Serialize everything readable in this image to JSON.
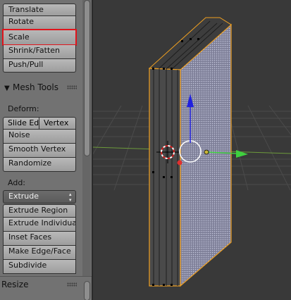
{
  "transform": {
    "buttons": [
      "Translate",
      "Rotate",
      "Scale",
      "Shrink/Fatten",
      "Push/Pull"
    ]
  },
  "mesh_tools": {
    "header": "Mesh Tools",
    "deform_label": "Deform:",
    "slide_edge": "Slide Ed",
    "vertex": "Vertex",
    "buttons": [
      "Noise",
      "Smooth Vertex",
      "Randomize"
    ],
    "add_label": "Add:",
    "extrude_select": "Extrude",
    "add_buttons": [
      "Extrude Region",
      "Extrude Individual",
      "Inset Faces",
      "Make Edge/Face",
      "Subdivide"
    ]
  },
  "resize_panel": {
    "title": "Resize"
  },
  "colors": {
    "highlight": "#e0141c",
    "selection_outline": "#f0a020",
    "axis_x": "#3fd13f",
    "axis_z": "#2020e0",
    "grid_x_line": "#6d9b3b"
  }
}
